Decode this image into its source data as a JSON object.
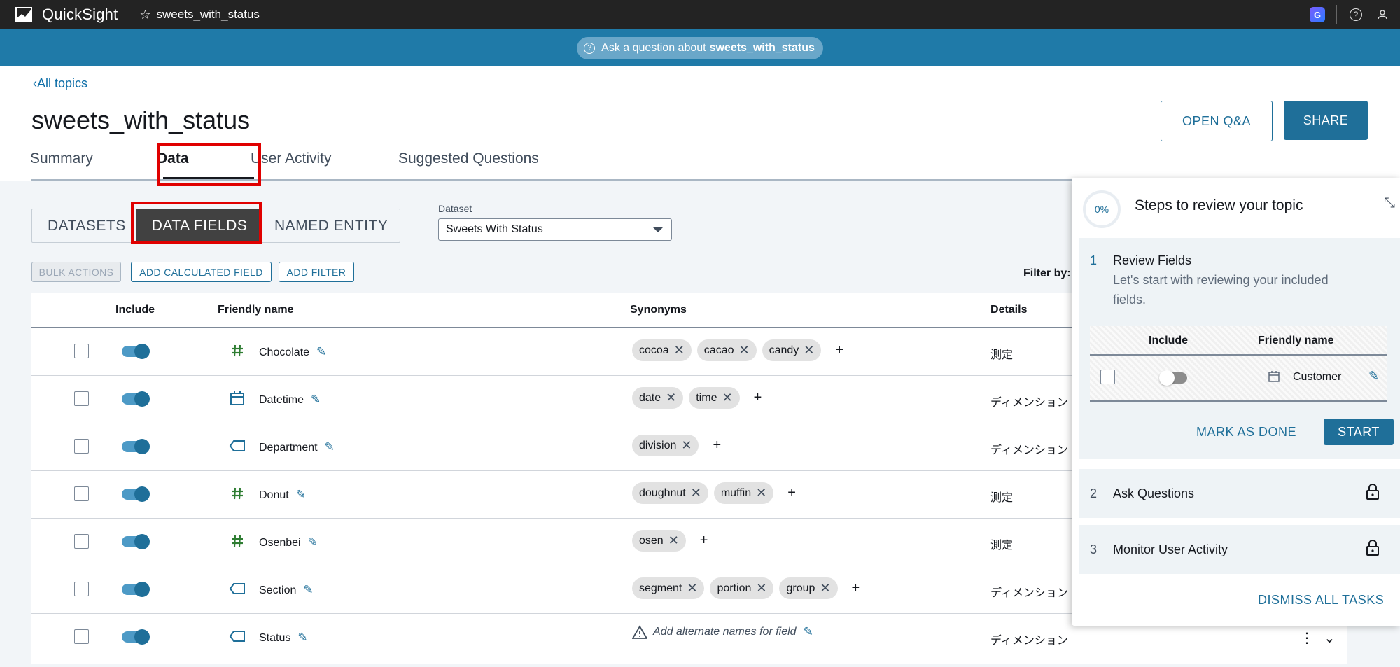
{
  "app": {
    "name": "QuickSight",
    "dataset_title": "sweets_with_status"
  },
  "askbar": {
    "prefix": "Ask a question about",
    "topic": "sweets_with_status"
  },
  "header": {
    "back_label": "All topics",
    "title": "sweets_with_status",
    "open_qa_label": "OPEN Q&A",
    "share_label": "SHARE",
    "tabs": [
      "Summary",
      "Data",
      "User Activity",
      "Suggested Questions"
    ],
    "active_tab": "Data"
  },
  "segments": {
    "items": [
      "DATASETS",
      "DATA FIELDS",
      "NAMED ENTITY"
    ],
    "selected": "DATA FIELDS"
  },
  "dataset": {
    "label": "Dataset",
    "value": "Sweets With Status"
  },
  "toolbar": {
    "bulk": "BULK ACTIONS",
    "add_calc": "ADD CALCULATED FIELD",
    "add_filter": "ADD FILTER",
    "filter_by": "Filter by:"
  },
  "table": {
    "headers": {
      "include": "Include",
      "friendly": "Friendly name",
      "synonyms": "Synonyms",
      "details": "Details"
    },
    "rows": [
      {
        "name": "Chocolate",
        "type": "measure",
        "synonyms": [
          "cocoa",
          "cacao",
          "candy"
        ],
        "details": "測定"
      },
      {
        "name": "Datetime",
        "type": "date",
        "synonyms": [
          "date",
          "time"
        ],
        "details": "ディメンション"
      },
      {
        "name": "Department",
        "type": "dimension",
        "synonyms": [
          "division"
        ],
        "details": "ディメンション"
      },
      {
        "name": "Donut",
        "type": "measure",
        "synonyms": [
          "doughnut",
          "muffin"
        ],
        "details": "測定"
      },
      {
        "name": "Osenbei",
        "type": "measure",
        "synonyms": [
          "osen"
        ],
        "details": "測定"
      },
      {
        "name": "Section",
        "type": "dimension",
        "synonyms": [
          "segment",
          "portion",
          "group"
        ],
        "details": "ディメンション"
      },
      {
        "name": "Status",
        "type": "dimension",
        "synonyms": [],
        "placeholder": "Add alternate names for field",
        "details": "ディメンション"
      }
    ]
  },
  "panel": {
    "progress": "0%",
    "title": "Steps to review your topic",
    "step1": {
      "num": "1",
      "title": "Review Fields",
      "desc": "Let's start with reviewing your included fields.",
      "mini_include": "Include",
      "mini_friendly": "Friendly name",
      "mini_field": "Customer",
      "mark_done": "MARK AS DONE",
      "start": "START"
    },
    "step2": {
      "num": "2",
      "title": "Ask Questions"
    },
    "step3": {
      "num": "3",
      "title": "Monitor User Activity"
    },
    "dismiss": "DISMISS ALL TASKS"
  },
  "colors": {
    "accent": "#1f6f99",
    "askbar": "#1f7aa8",
    "measure_icon": "#2e7d32",
    "dimension_icon": "#1f6f99",
    "highlight": "#e00000"
  }
}
